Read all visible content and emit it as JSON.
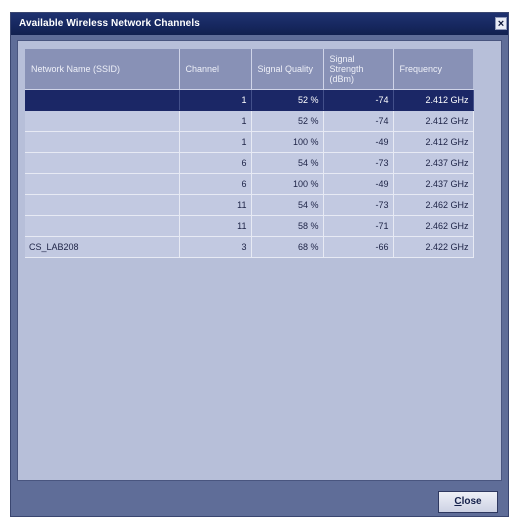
{
  "dialog": {
    "title": "Available Wireless Network Channels",
    "close_glyph": "×",
    "close_button": {
      "mnemonic": "C",
      "rest": "lose"
    }
  },
  "table": {
    "columns": [
      "Network Name (SSID)",
      "Channel",
      "Signal Quality",
      "Signal Strength (dBm)",
      "Frequency"
    ],
    "selected_row": 0,
    "rows": [
      {
        "ssid": "",
        "channel": "1",
        "quality": "52 %",
        "strength": "-74",
        "frequency": "2.412 GHz"
      },
      {
        "ssid": "",
        "channel": "1",
        "quality": "52 %",
        "strength": "-74",
        "frequency": "2.412 GHz"
      },
      {
        "ssid": "",
        "channel": "1",
        "quality": "100 %",
        "strength": "-49",
        "frequency": "2.412 GHz"
      },
      {
        "ssid": "",
        "channel": "6",
        "quality": "54 %",
        "strength": "-73",
        "frequency": "2.437 GHz"
      },
      {
        "ssid": "",
        "channel": "6",
        "quality": "100 %",
        "strength": "-49",
        "frequency": "2.437 GHz"
      },
      {
        "ssid": "",
        "channel": "11",
        "quality": "54 %",
        "strength": "-73",
        "frequency": "2.462 GHz"
      },
      {
        "ssid": "",
        "channel": "11",
        "quality": "58 %",
        "strength": "-71",
        "frequency": "2.462 GHz"
      },
      {
        "ssid": "CS_LAB208",
        "channel": "3",
        "quality": "68 %",
        "strength": "-66",
        "frequency": "2.422 GHz"
      }
    ]
  }
}
